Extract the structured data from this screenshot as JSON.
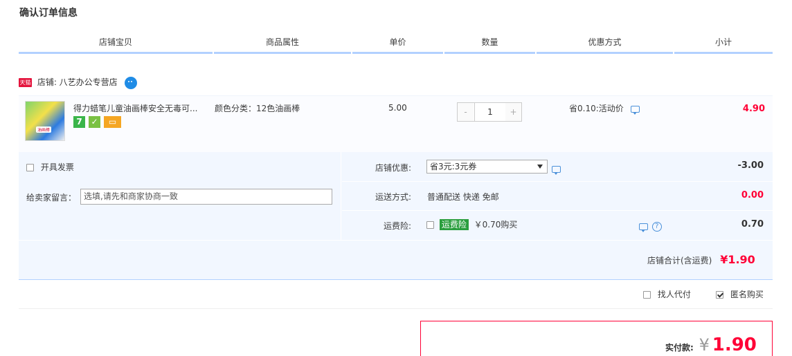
{
  "page": {
    "title": "确认订单信息"
  },
  "table_header": {
    "columns": [
      "店铺宝贝",
      "商品属性",
      "单价",
      "数量",
      "优惠方式",
      "小计"
    ]
  },
  "shop": {
    "badge": "天猫",
    "name": "店铺: 八艺办公专营店",
    "wangwang_icon": "wangwang-chat-icon"
  },
  "item": {
    "thumb_label": "油画棒",
    "title": "得力蜡笔儿童油画棒安全无毒可...",
    "service_icons": [
      {
        "name": "seven-day-return-icon",
        "text": "7",
        "color": "#3ab54a"
      },
      {
        "name": "quality-guarantee-icon",
        "text": "✓",
        "color": "#7ac143"
      },
      {
        "name": "credit-card-icon",
        "text": "▭",
        "color": "#f5a623"
      }
    ],
    "sku": "颜色分类：12色油画棒",
    "price": "5.00",
    "quantity": {
      "minus": "-",
      "value": "1",
      "plus": "+"
    },
    "promo": "省0.10:活动价",
    "subtotal": "4.90"
  },
  "options": {
    "invoice_label": "开具发票",
    "memo_label": "给卖家留言：",
    "memo_placeholder": "选填,请先和商家协商一致",
    "shop_discount_label": "店铺优惠:",
    "shop_discount_value": "省3元:3元券",
    "shop_discount_amount": "-3.00",
    "shipping_label": "运送方式:",
    "shipping_value": "普通配送 快递 免邮",
    "shipping_amount": "0.00",
    "insurance_label": "运费险:",
    "insurance_badge": "运费险",
    "insurance_value": "￥0.70购买",
    "insurance_amount": "0.70"
  },
  "shop_total": {
    "label": "店铺合计(含运费)",
    "value": "¥1.90"
  },
  "pay_options": {
    "proxy_pay": "找人代付",
    "anonymous": "匿名购买",
    "anonymous_checked": true,
    "proxy_checked": false
  },
  "payment": {
    "label": "实付款:",
    "currency": "¥",
    "amount": "1.90"
  },
  "colors": {
    "accent_red": "#ff0036",
    "header_border": "#b2d1ff",
    "panel_bg": "#f2f7ff"
  }
}
